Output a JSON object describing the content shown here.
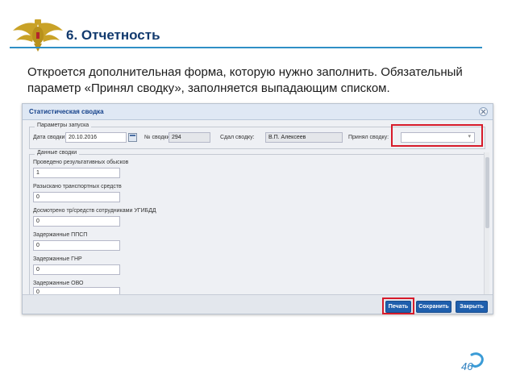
{
  "slide": {
    "title": "6. Отчетность",
    "intro": "Откроется дополнительная форма, которую нужно заполнить. Обязательный параметр «Принял сводку», заполняется выпадающим списком.",
    "page_number": "46"
  },
  "dialog": {
    "title": "Статистическая сводка",
    "params": {
      "legend": "Параметры запуска",
      "date_label": "Дата сводки:",
      "date_value": "20.10.2016",
      "number_label": "№ сводки:",
      "number_value": "294",
      "handed_label": "Сдал сводку:",
      "handed_value": "В.П. Алексеев",
      "accepted_label": "Принял сводку:",
      "accepted_value": ""
    },
    "data": {
      "legend": "Данные сводки",
      "fields": [
        {
          "label": "Проведено результативных обысков",
          "value": "1"
        },
        {
          "label": "Разыскано транспортных средств",
          "value": "0"
        },
        {
          "label": "Досмотрено тр/средств сотрудниками УГИБДД",
          "value": "0"
        },
        {
          "label": "Задержанные ППСП",
          "value": "0"
        },
        {
          "label": "Задержанные ГНР",
          "value": "0"
        },
        {
          "label": "Задержанные ОВО",
          "value": "0"
        }
      ]
    },
    "buttons": {
      "print": "Печать",
      "save": "Сохранить",
      "close": "Закрыть"
    }
  },
  "colors": {
    "title": "#123a6e",
    "accent_rule": "#2f8fc6",
    "highlight": "#d71b2a",
    "button": "#1f5fad"
  },
  "icons": [
    "emblem-icon",
    "calendar-icon",
    "dropdown-arrow-icon",
    "close-icon",
    "page-swirl-icon"
  ]
}
